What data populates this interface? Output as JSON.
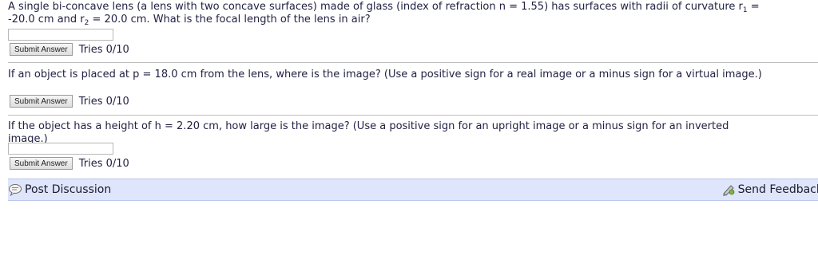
{
  "questions": [
    {
      "line1_a": "A single bi-concave lens (a lens with two concave surfaces) made of glass (index of refraction n = 1.55) has surfaces with radii of curvature r",
      "line1_sub": "1",
      "line1_b": " =",
      "line2_a": "-20.0 cm and r",
      "line2_sub": "2",
      "line2_b": " = 20.0 cm. What is the focal length of the lens in air?"
    },
    {
      "line1": "If an object is placed at p = 18.0 cm from the lens, where is the image? (Use a positive sign for a real image or a minus sign for a virtual image.)"
    },
    {
      "line1": "If the object has a height of h = 2.20 cm, how large is the image? (Use a positive sign for an upright image or a minus sign for an inverted",
      "line2": "image.)"
    }
  ],
  "submit_label": "Submit Answer",
  "tries_label": "Tries 0/10",
  "discussion": {
    "post_label": "Post Discussion",
    "feedback_label": "Send Feedback"
  }
}
